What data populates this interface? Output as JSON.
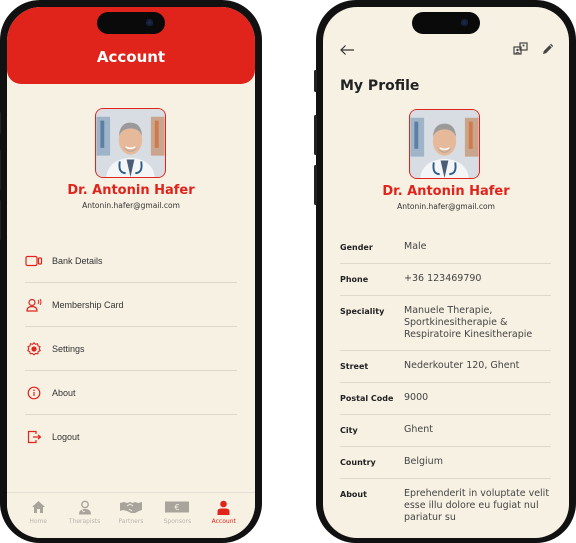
{
  "account_screen": {
    "header_title": "Account",
    "profile": {
      "name": "Dr. Antonin Hafer",
      "email": "Antonin.hafer@gmail.com"
    },
    "menu": [
      {
        "label": "Bank Details",
        "icon": "bank-card-icon"
      },
      {
        "label": "Membership Card",
        "icon": "membership-user-icon"
      },
      {
        "label": "Settings",
        "icon": "gear-icon"
      },
      {
        "label": "About",
        "icon": "info-icon"
      },
      {
        "label": "Logout",
        "icon": "logout-icon"
      }
    ],
    "tabs": [
      {
        "label": "Home",
        "icon": "home-icon",
        "active": false
      },
      {
        "label": "Therapists",
        "icon": "therapist-icon",
        "active": false
      },
      {
        "label": "Partners",
        "icon": "handshake-icon",
        "active": false
      },
      {
        "label": "Sponsors",
        "icon": "euro-note-icon",
        "active": false
      },
      {
        "label": "Account",
        "icon": "user-icon",
        "active": true
      }
    ]
  },
  "profile_screen": {
    "title": "My Profile",
    "profile": {
      "name": "Dr. Antonin Hafer",
      "email": "Antonin.hafer@gmail.com"
    },
    "fields": [
      {
        "label": "Gender",
        "value": "Male"
      },
      {
        "label": "Phone",
        "value": "+36 123469790"
      },
      {
        "label": "Speciality",
        "value": "Manuele Therapie, Sportkinesitherapie & Respiratoire Kinesitherapie"
      },
      {
        "label": "Street",
        "value": "Nederkouter 120, Ghent"
      },
      {
        "label": "Postal Code",
        "value": "9000"
      },
      {
        "label": "City",
        "value": "Ghent"
      },
      {
        "label": "Country",
        "value": "Belgium"
      },
      {
        "label": "About",
        "value": "Eprehenderit in voluptate velit esse illu dolore eu fugiat nul pariatur su"
      }
    ]
  },
  "colors": {
    "accent": "#e0231b",
    "background": "#f7f1e4",
    "inactive_tab": "#b8b4ab"
  }
}
